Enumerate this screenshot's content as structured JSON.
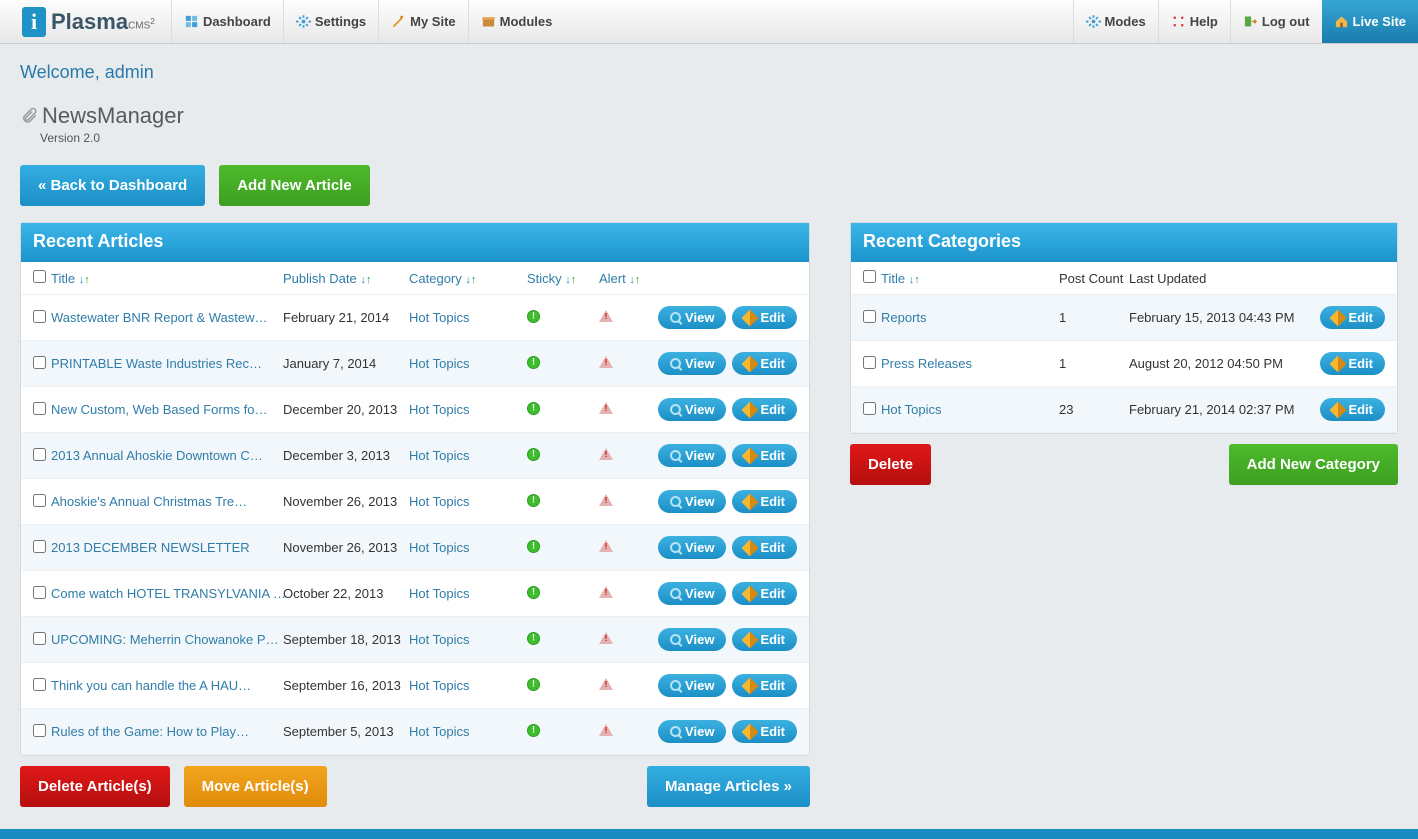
{
  "brand": {
    "name": "Plasma",
    "suffix": "CMS",
    "sup": "2"
  },
  "nav_left": [
    {
      "label": "Dashboard",
      "icon": "dashboard"
    },
    {
      "label": "Settings",
      "icon": "gear"
    },
    {
      "label": "My Site",
      "icon": "pencil"
    },
    {
      "label": "Modules",
      "icon": "box"
    }
  ],
  "nav_right": [
    {
      "label": "Modes",
      "icon": "gear"
    },
    {
      "label": "Help",
      "icon": "help"
    },
    {
      "label": "Log out",
      "icon": "logout"
    },
    {
      "label": "Live Site",
      "icon": "home"
    }
  ],
  "welcome": "Welcome, admin",
  "module": {
    "name": "NewsManager",
    "version": "Version 2.0"
  },
  "buttons": {
    "back": "« Back to Dashboard",
    "add_article": "Add New Article",
    "delete_articles": "Delete Article(s)",
    "move_articles": "Move Article(s)",
    "manage_articles": "Manage Articles »",
    "delete": "Delete",
    "add_category": "Add New Category",
    "view": "View",
    "edit": "Edit"
  },
  "articles_panel": {
    "title": "Recent Articles",
    "headers": {
      "title": "Title",
      "publish": "Publish Date",
      "category": "Category",
      "sticky": "Sticky",
      "alert": "Alert"
    },
    "rows": [
      {
        "title": "Wastewater BNR Report & Wastew…",
        "date": "February 21, 2014",
        "cat": "Hot Topics"
      },
      {
        "title": "PRINTABLE Waste Industries Rec…",
        "date": "January 7, 2014",
        "cat": "Hot Topics"
      },
      {
        "title": "New Custom, Web Based Forms fo…",
        "date": "December 20, 2013",
        "cat": "Hot Topics"
      },
      {
        "title": "2013 Annual Ahoskie Downtown C…",
        "date": "December 3, 2013",
        "cat": "Hot Topics"
      },
      {
        "title": "Ahoskie's Annual Christmas Tre…",
        "date": "November 26, 2013",
        "cat": "Hot Topics"
      },
      {
        "title": "2013 DECEMBER NEWSLETTER",
        "date": "November 26, 2013",
        "cat": "Hot Topics"
      },
      {
        "title": "Come watch HOTEL TRANSYLVANIA …",
        "date": "October 22, 2013",
        "cat": "Hot Topics"
      },
      {
        "title": "UPCOMING: Meherrin Chowanoke P…",
        "date": "September 18, 2013",
        "cat": "Hot Topics"
      },
      {
        "title": "Think you can handle the A HAU…",
        "date": "September 16, 2013",
        "cat": "Hot Topics"
      },
      {
        "title": "Rules of the Game: How to Play…",
        "date": "September 5, 2013",
        "cat": "Hot Topics"
      }
    ]
  },
  "categories_panel": {
    "title": "Recent Categories",
    "headers": {
      "title": "Title",
      "count": "Post Count",
      "updated": "Last Updated"
    },
    "rows": [
      {
        "title": "Reports",
        "count": "1",
        "updated": "February 15, 2013 04:43 PM"
      },
      {
        "title": "Press Releases",
        "count": "1",
        "updated": "August 20, 2012 04:50 PM"
      },
      {
        "title": "Hot Topics",
        "count": "23",
        "updated": "February 21, 2014 02:37 PM"
      }
    ]
  }
}
